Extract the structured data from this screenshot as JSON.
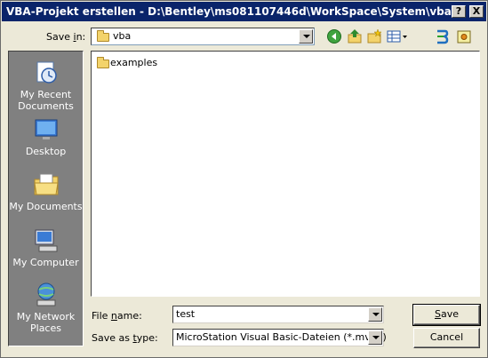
{
  "window": {
    "title": "VBA-Projekt erstellen - D:\\Bentley\\ms081107446d\\WorkSpace\\System\\vba\\",
    "help_button": "?",
    "close_button": "X"
  },
  "save_in": {
    "label_prefix": "Save ",
    "label_underlined": "i",
    "label_suffix": "n:",
    "value": "vba"
  },
  "toolbar": {
    "icons": [
      "back-icon",
      "up-folder-icon",
      "new-folder-icon",
      "view-menu-icon"
    ],
    "extra_icons": [
      "bentley-icon",
      "configuration-icon"
    ]
  },
  "places": [
    {
      "label_line1": "My Recent",
      "label_line2": "Documents",
      "icon": "recent-documents-icon"
    },
    {
      "label_line1": "Desktop",
      "label_line2": "",
      "icon": "desktop-icon"
    },
    {
      "label_line1": "My Documents",
      "label_line2": "",
      "icon": "my-documents-icon"
    },
    {
      "label_line1": "My Computer",
      "label_line2": "",
      "icon": "my-computer-icon"
    },
    {
      "label_line1": "My Network",
      "label_line2": "Places",
      "icon": "network-places-icon"
    }
  ],
  "files": [
    {
      "name": "examples",
      "type": "folder"
    }
  ],
  "file_name": {
    "label_prefix": "File ",
    "label_underlined": "n",
    "label_suffix": "ame:",
    "value": "test"
  },
  "save_as_type": {
    "label_prefix": "Save as ",
    "label_underlined": "t",
    "label_suffix": "ype:",
    "value": "MicroStation Visual Basic-Dateien (*.mvba)"
  },
  "buttons": {
    "save_underlined": "S",
    "save_rest": "ave",
    "cancel": "Cancel"
  },
  "colors": {
    "titlebar": "#0a246a",
    "dialog_bg": "#ece9d8",
    "places_bg": "#808080"
  }
}
